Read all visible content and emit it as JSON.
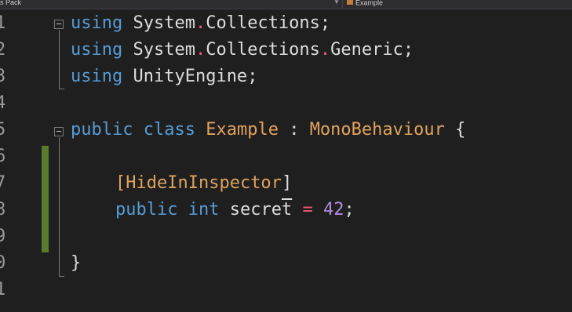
{
  "toolbar": {
    "project_label": "s Pack",
    "class_label": "Example"
  },
  "editor": {
    "line_numbers": [
      "1",
      "2",
      "3",
      "4",
      "5",
      "6",
      "7",
      "8",
      "9",
      "0",
      "1"
    ],
    "lines": {
      "l1": {
        "kw": "using",
        "ns1": "System",
        "dot1": ".",
        "ns2": "Collections",
        "semi": ";"
      },
      "l2": {
        "kw": "using",
        "ns1": "System",
        "dot1": ".",
        "ns2": "Collections",
        "dot2": ".",
        "ns3": "Generic",
        "semi": ";"
      },
      "l3": {
        "kw": "using",
        "ns1": "UnityEngine",
        "semi": ";"
      },
      "l5": {
        "kw1": "public",
        "kw2": "class",
        "name": "Example",
        "colon": ":",
        "base": "MonoBehaviour",
        "brace": "{"
      },
      "l7": {
        "open": "[",
        "attr": "HideInInspector",
        "close": "]"
      },
      "l8": {
        "kw1": "public",
        "kw2": "int",
        "ident_a": "secre",
        "ident_b": "t",
        "eq": "=",
        "num": "42",
        "semi": ";"
      },
      "l10": {
        "brace": "}"
      }
    }
  },
  "colors": {
    "background": "#1f1f1f",
    "keyword": "#569cd6",
    "type": "#e0a25e",
    "number": "#b58ce0",
    "operator": "#f05a7a",
    "change_bar": "#587c2d"
  }
}
